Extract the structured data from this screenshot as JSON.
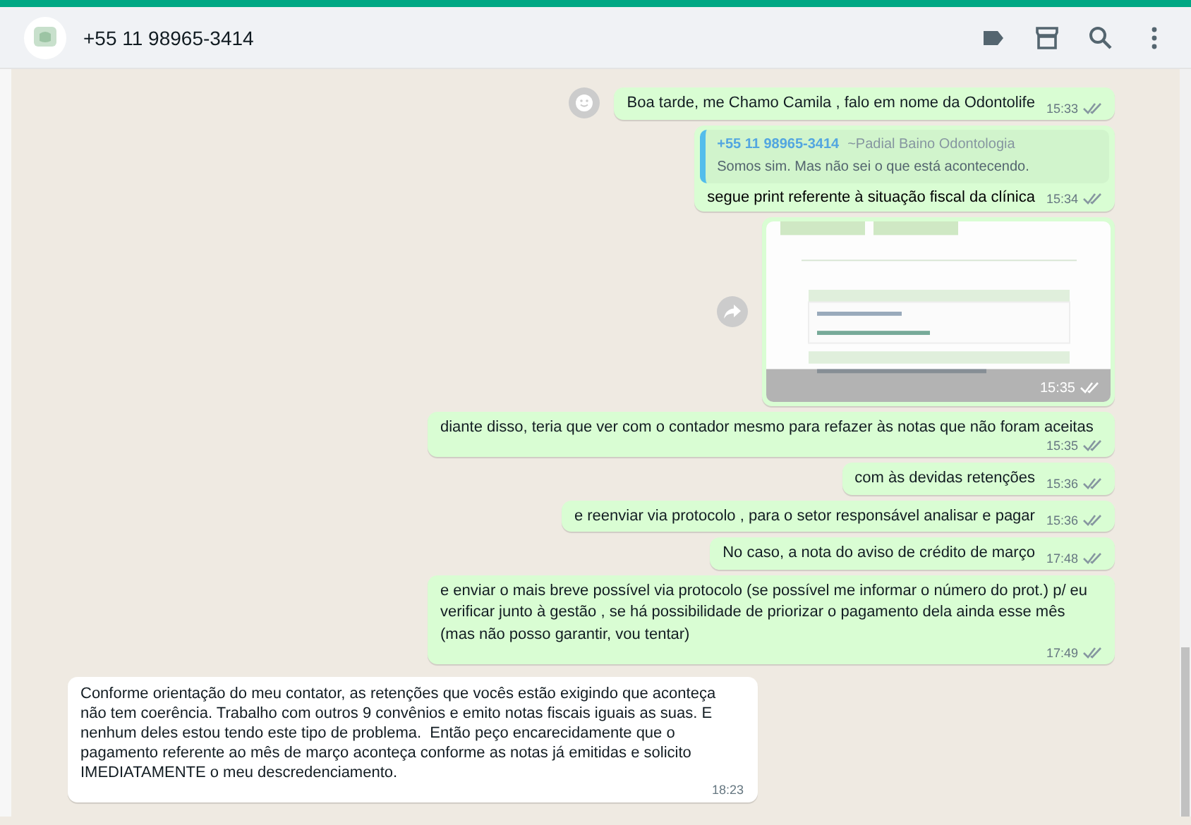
{
  "header": {
    "title": "+55 11 98965-3414"
  },
  "messages": [
    {
      "kind": "text",
      "outgoing": true,
      "text": "Boa tarde, me Chamo Camila , falo em nome da Odontolife",
      "time": "15:33",
      "read": false,
      "react_button": true
    },
    {
      "kind": "quote",
      "outgoing": true,
      "quote_author": "+55 11 98965-3414",
      "quote_name": "~Padial Baino Odontologia",
      "quote_text": "Somos sim. Mas não sei o que está acontecendo.",
      "text": "segue print referente à situação fiscal da clínica",
      "time": "15:34",
      "read": false
    },
    {
      "outgoing": true,
      "time": "15:35",
      "read": false,
      "forward_button": true
    },
    {
      "kind": "text",
      "outgoing": true,
      "text": "diante disso, teria que ver com o contador mesmo para refazer às notas que não foram aceitas",
      "time": "15:35",
      "read": false
    },
    {
      "kind": "text",
      "outgoing": true,
      "text": "com às devidas retenções",
      "time": "15:36",
      "read": false
    },
    {
      "kind": "text",
      "outgoing": true,
      "text": "e reenviar via protocolo , para o setor responsável analisar e pagar",
      "time": "15:36",
      "read": false
    },
    {
      "kind": "text",
      "outgoing": true,
      "text": "No caso, a nota do aviso de crédito de março",
      "time": "17:48",
      "read": false
    },
    {
      "kind": "text",
      "outgoing": true,
      "text": "e enviar o mais breve possível via protocolo (se possível me informar o número do prot.) p/ eu verificar junto à gestão , se há possibilidade de priorizar o pagamento dela ainda esse mês (mas não posso garantir, vou tentar)",
      "time": "17:49",
      "read": false
    },
    {
      "kind": "text",
      "outgoing": false,
      "text": "Conforme orientação do meu contator, as retenções que vocês estão exigindo que aconteça não tem coerência. Trabalho com outros 9 convênios e emito notas fiscais iguais as suas. E nenhum deles estou tendo este tipo de problema.  Então peço encarecidamente que o pagamento referente ao mês de março aconteça conforme as notas já emitidas e solicito IMEDIATAMENTE o meu descredenciamento.",
      "time": "18:23"
    }
  ]
}
